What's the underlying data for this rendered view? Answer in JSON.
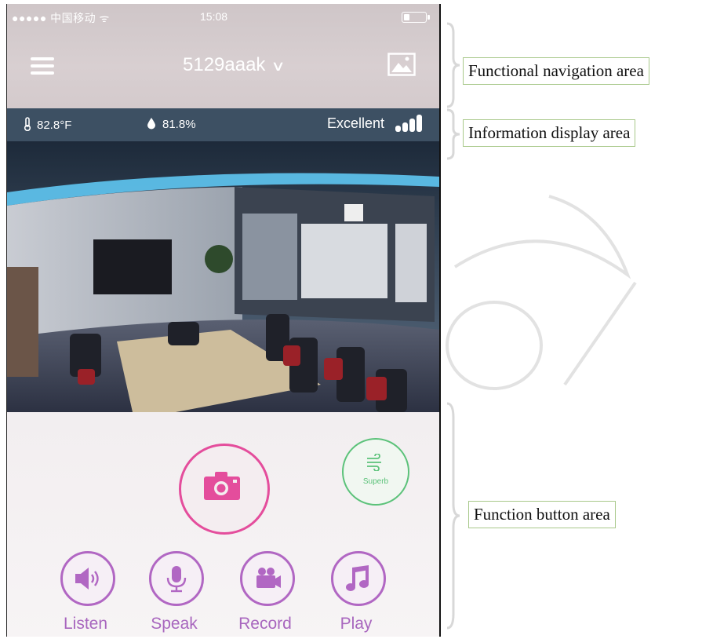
{
  "status_bar": {
    "carrier": "●●●●● 中国移动 ᯤ",
    "time": "15:08"
  },
  "nav": {
    "device_name": "5129aaak",
    "dropdown_glyph": "∨"
  },
  "info": {
    "temperature": "82.8°F",
    "humidity": "81.8%",
    "signal_quality": "Excellent"
  },
  "controls": {
    "superb_label": "Superb",
    "buttons": [
      {
        "label": "Listen",
        "icon": "speaker-icon"
      },
      {
        "label": "Speak",
        "icon": "microphone-icon"
      },
      {
        "label": "Record",
        "icon": "video-camera-icon"
      },
      {
        "label": "Play",
        "icon": "music-note-icon"
      }
    ]
  },
  "annotations": {
    "navigation": "Functional navigation area",
    "information": "Information display area",
    "buttons": "Function button area"
  },
  "colors": {
    "accent_pink": "#e44d9c",
    "accent_purple": "#b167c3",
    "accent_green": "#5cc27a",
    "info_bar": "#3d5063"
  }
}
